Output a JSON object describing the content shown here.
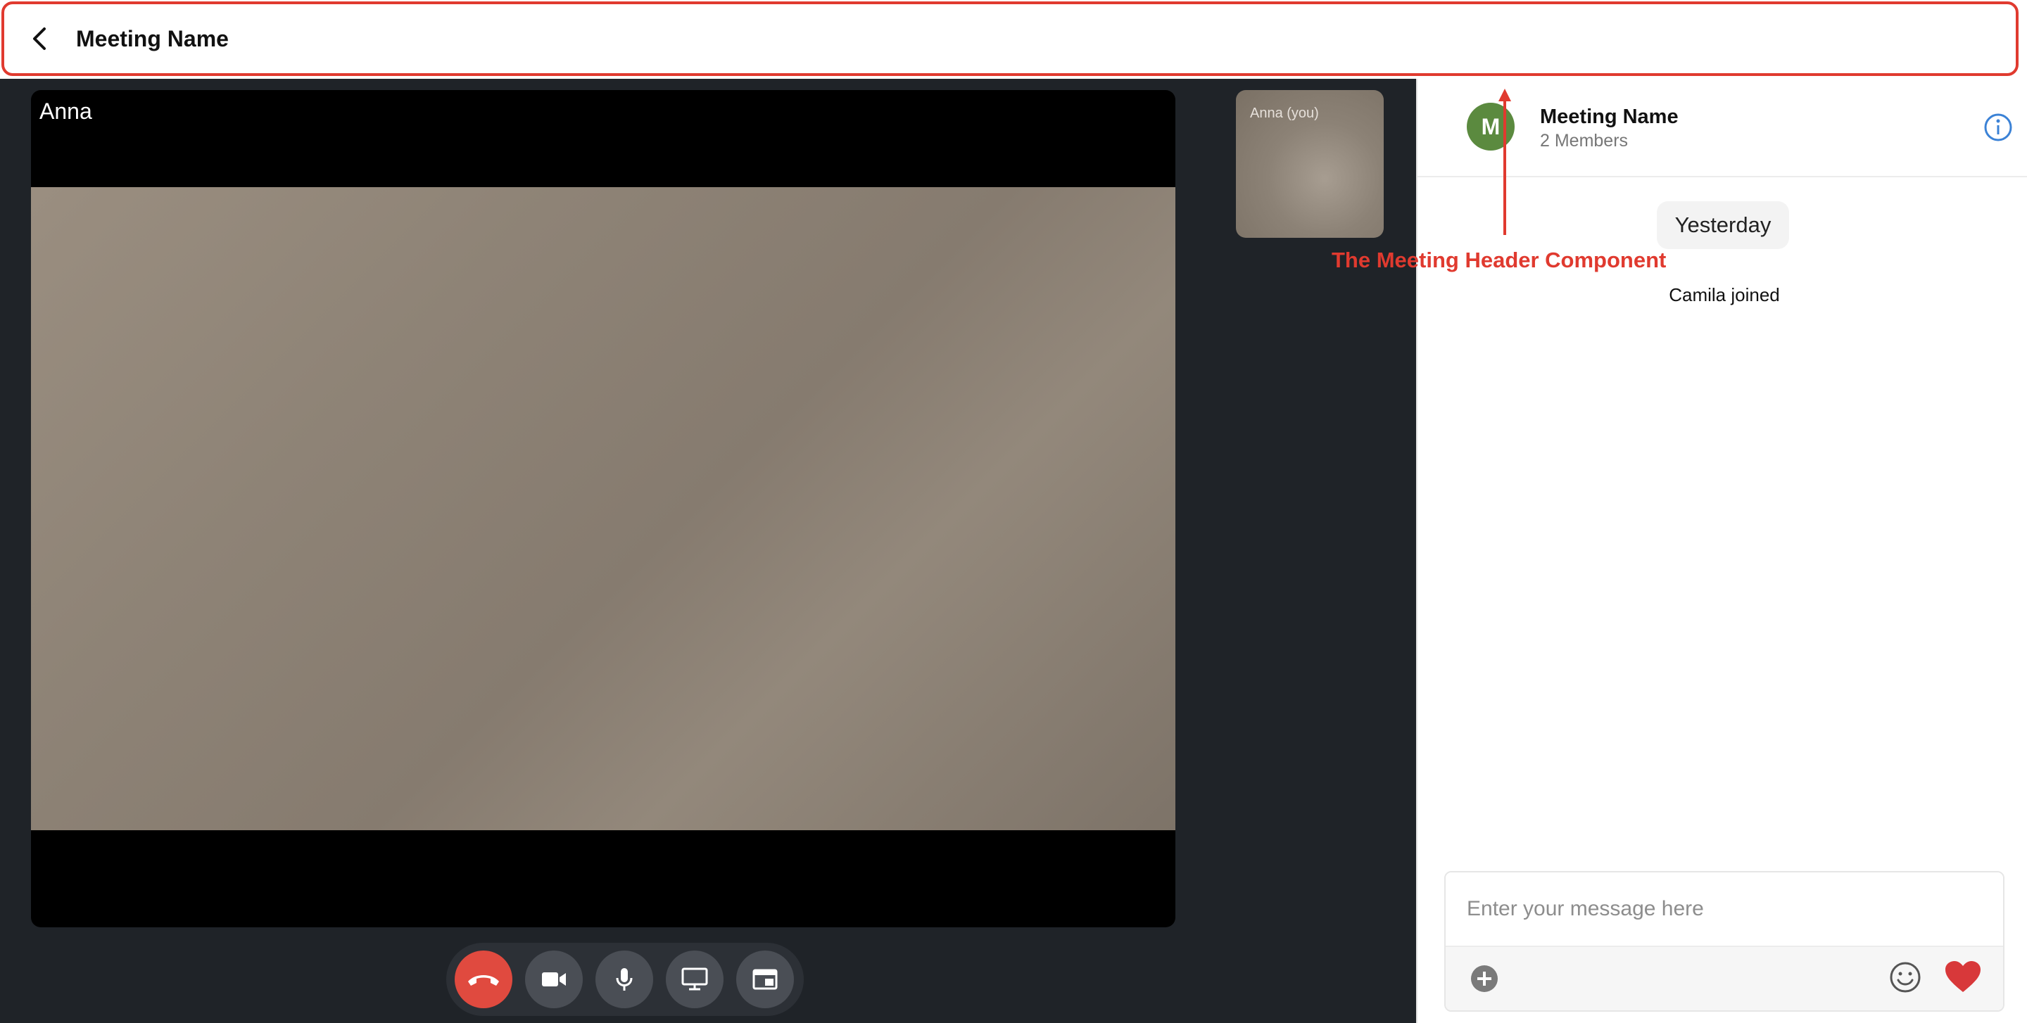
{
  "header": {
    "title": "Meeting Name",
    "back_icon": "chevron-left-icon"
  },
  "video": {
    "main_participant": "Anna",
    "self_participant": "Anna (you)",
    "controls": [
      {
        "name": "end-call-button",
        "icon": "phone-hangup-icon",
        "color": "#e04a3f"
      },
      {
        "name": "camera-toggle-button",
        "icon": "video-camera-icon"
      },
      {
        "name": "microphone-toggle-button",
        "icon": "microphone-icon"
      },
      {
        "name": "screen-share-button",
        "icon": "monitor-icon"
      },
      {
        "name": "layout-toggle-button",
        "icon": "window-layout-icon"
      }
    ]
  },
  "chat": {
    "avatar_initial": "M",
    "avatar_color": "#5b8a3f",
    "title": "Meeting Name",
    "members": "2 Members",
    "date_separator": "Yesterday",
    "system_message": "Camila joined",
    "input_placeholder": "Enter your message here"
  },
  "annotation": {
    "label": "The Meeting Header Component",
    "color": "#e03a2f"
  }
}
